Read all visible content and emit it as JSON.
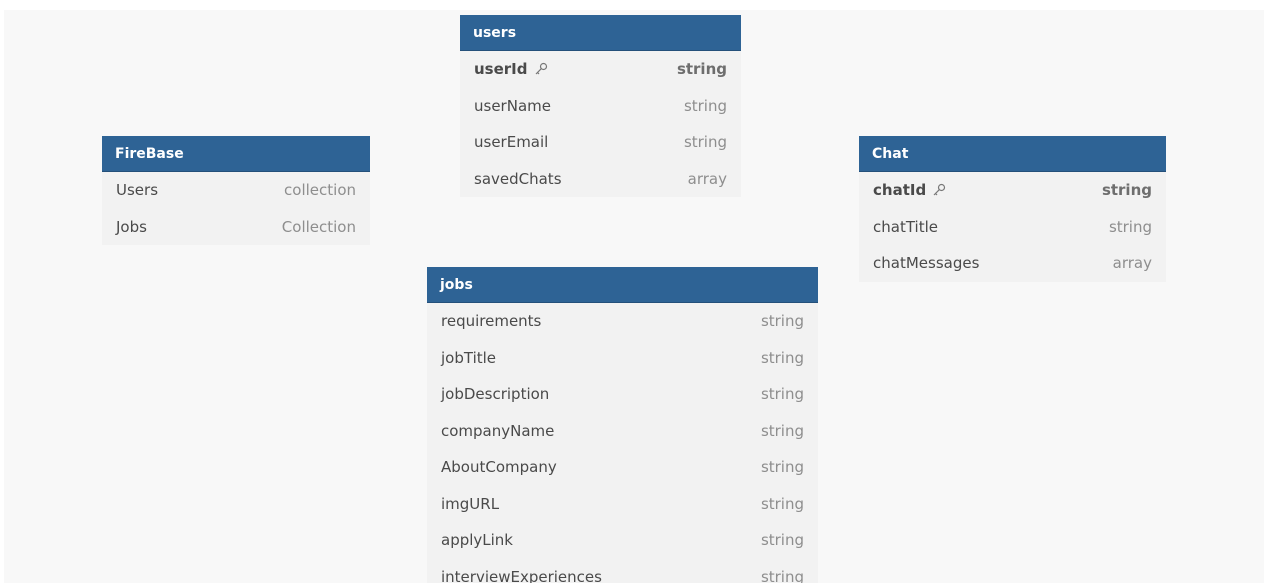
{
  "tables": {
    "users": {
      "title": "users",
      "fields": [
        {
          "name": "userId",
          "type": "string",
          "pk": true
        },
        {
          "name": "userName",
          "type": "string"
        },
        {
          "name": "userEmail",
          "type": "string"
        },
        {
          "name": "savedChats",
          "type": "array"
        }
      ]
    },
    "firebase": {
      "title": "FireBase",
      "fields": [
        {
          "name": "Users",
          "type": "collection"
        },
        {
          "name": "Jobs",
          "type": "Collection"
        }
      ]
    },
    "chat": {
      "title": "Chat",
      "fields": [
        {
          "name": "chatId",
          "type": "string",
          "pk": true
        },
        {
          "name": "chatTitle",
          "type": "string"
        },
        {
          "name": "chatMessages",
          "type": "array"
        }
      ]
    },
    "jobs": {
      "title": "jobs",
      "fields": [
        {
          "name": "requirements",
          "type": "string"
        },
        {
          "name": "jobTitle",
          "type": "string"
        },
        {
          "name": "jobDescription",
          "type": "string"
        },
        {
          "name": "companyName",
          "type": "string"
        },
        {
          "name": "AboutCompany",
          "type": "string"
        },
        {
          "name": "imgURL",
          "type": "string"
        },
        {
          "name": "applyLink",
          "type": "string"
        },
        {
          "name": "interviewExperiences",
          "type": "string"
        }
      ]
    }
  },
  "icons": {
    "primary_key": "key-icon"
  },
  "colors": {
    "header": "#2e6395",
    "table_body": "#f2f2f2",
    "canvas": "#f8f8f8"
  }
}
